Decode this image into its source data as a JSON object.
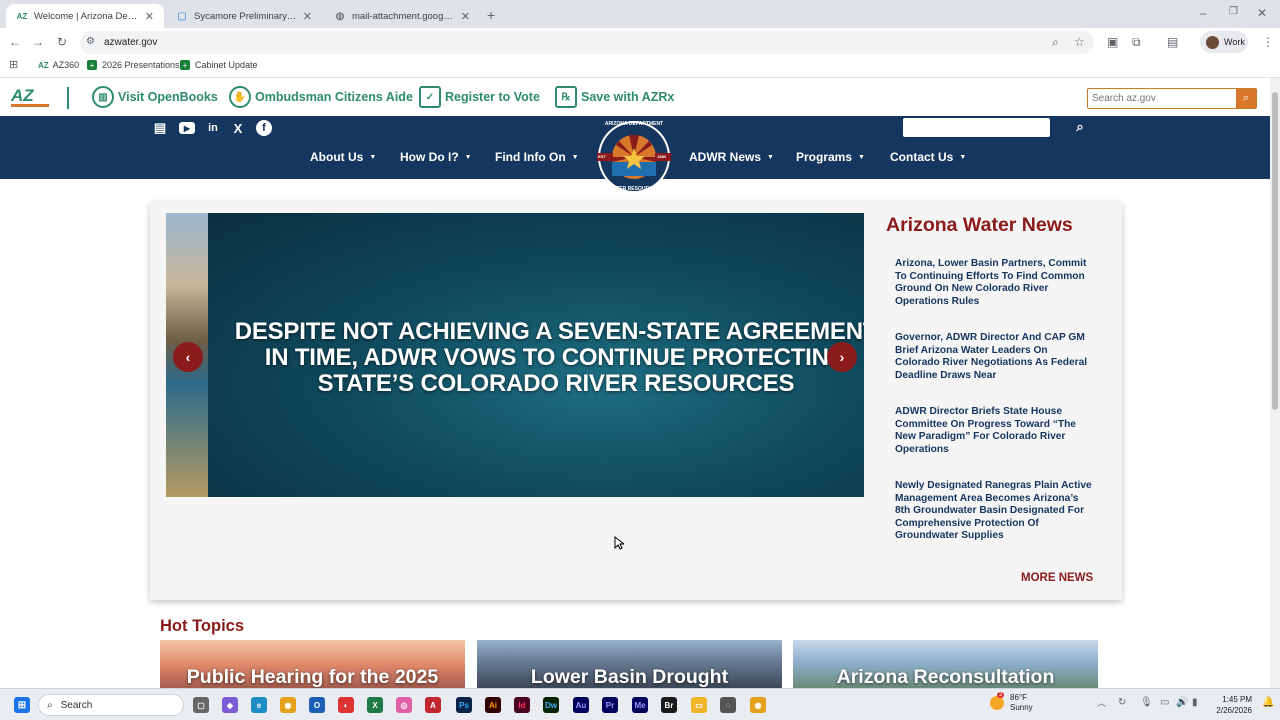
{
  "browser": {
    "tabs": [
      {
        "title": "Welcome | Arizona Department",
        "favicon": "az-icon",
        "active": true
      },
      {
        "title": "Sycamore Preliminary Hydrogra",
        "favicon": "doc-icon",
        "active": false
      },
      {
        "title": "mail-attachment.googleusercont",
        "favicon": "globe-icon",
        "active": false
      }
    ],
    "url": "azwater.gov",
    "profile": "Work",
    "bookmarks": [
      "AZ360",
      "2026 Presentations",
      "Cabinet Update"
    ]
  },
  "utility_bar": {
    "links": [
      "Visit OpenBooks",
      "Ombudsman Citizens Aide",
      "Register to Vote",
      "Save with AZRx"
    ],
    "search_placeholder": "Search az.gov"
  },
  "nav": {
    "items": [
      "About Us",
      "How Do I?",
      "Find Info On",
      "ADWR News",
      "Programs",
      "Contact Us"
    ],
    "logo_top": "ARIZONA DEPARTMENT",
    "logo_bottom": "WATER RESOURCES",
    "logo_est": "EST",
    "logo_year": "1980"
  },
  "hero": {
    "headline": "DESPITE NOT ACHIEVING A SEVEN-STATE AGREEMENT IN TIME, ADWR VOWS TO CONTINUE PROTECTING STATE’S COLORADO RIVER RESOURCES"
  },
  "news": {
    "heading": "Arizona Water News",
    "items": [
      "Arizona, Lower Basin Partners, Commit To Continuing Efforts To Find Common Ground On New Colorado River Operations Rules",
      "Governor, ADWR Director And CAP GM Brief Arizona Water Leaders On Colorado River Negotiations As Federal Deadline Draws Near",
      "ADWR Director Briefs State House Committee On Progress Toward “The New Paradigm” For Colorado River Operations",
      "Newly Designated Ranegras Plain Active Management Area Becomes Arizona’s 8th Groundwater Basin Designated For Comprehensive Protection Of Groundwater Supplies"
    ],
    "more": "MORE NEWS"
  },
  "hot_topics": {
    "heading": "Hot Topics",
    "items": [
      "Public Hearing for the 2025",
      "Lower Basin Drought",
      "Arizona Reconsultation"
    ]
  },
  "taskbar": {
    "search": "Search",
    "weather_temp": "86°F",
    "weather_desc": "Sunny",
    "weather_badge": "2",
    "time": "1:45 PM",
    "date": "2/26/2026",
    "apps": [
      "Ai",
      "Id",
      "Dw",
      "Au",
      "Ps",
      "Pr",
      "Me",
      "Br"
    ]
  },
  "colors": {
    "navy": "#15365f",
    "maroon": "#8b1a1a",
    "teal": "#2e8b72",
    "orange": "#d9782a"
  }
}
